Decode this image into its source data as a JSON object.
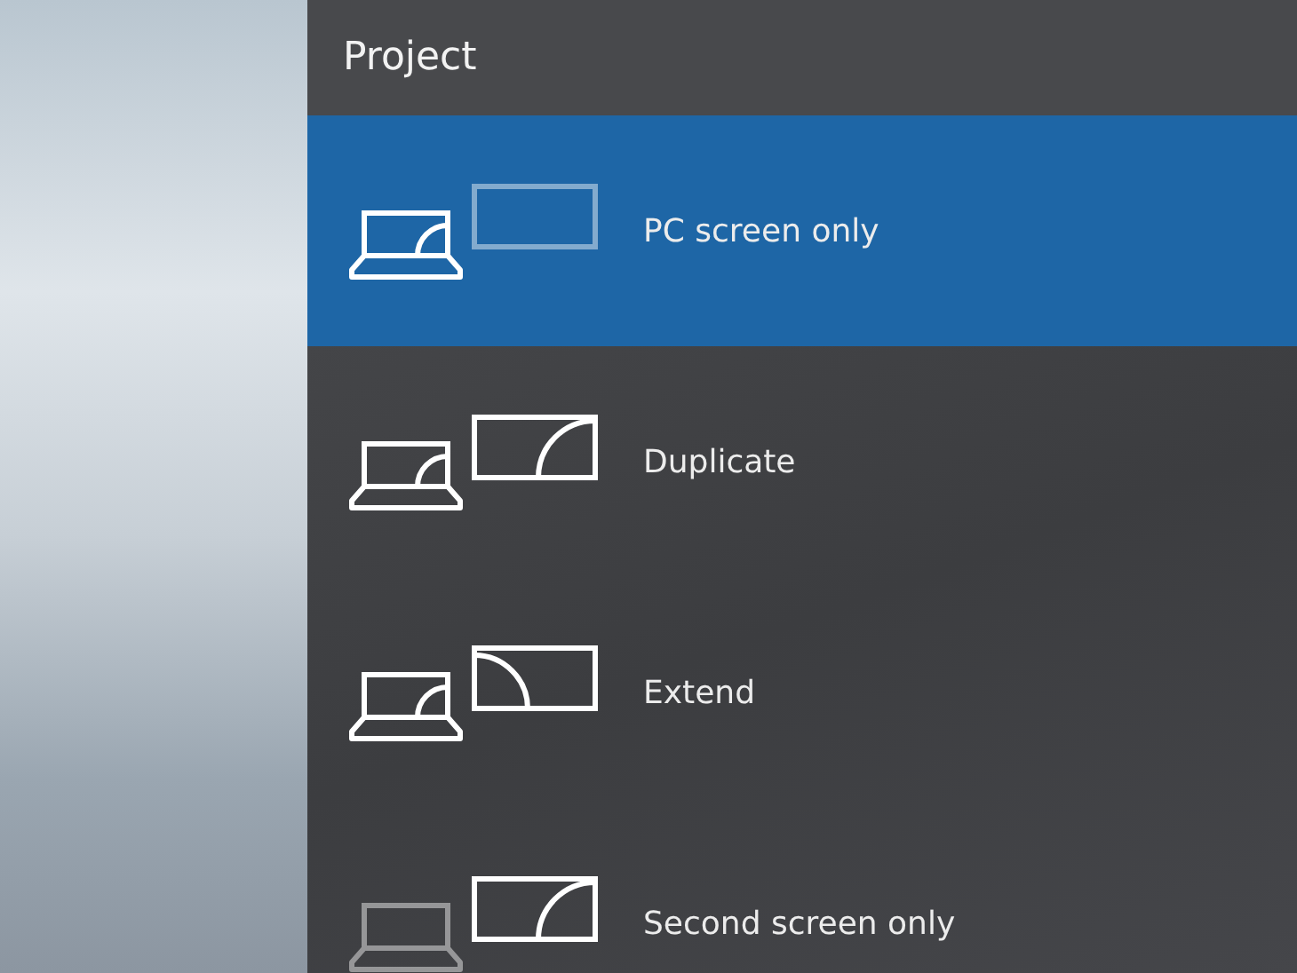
{
  "panel": {
    "title": "Project"
  },
  "options": [
    {
      "label": "PC screen only",
      "kind": "pc_only",
      "selected": true
    },
    {
      "label": "Duplicate",
      "kind": "duplicate",
      "selected": false
    },
    {
      "label": "Extend",
      "kind": "extend",
      "selected": false
    },
    {
      "label": "Second screen only",
      "kind": "second_only",
      "selected": false
    }
  ]
}
